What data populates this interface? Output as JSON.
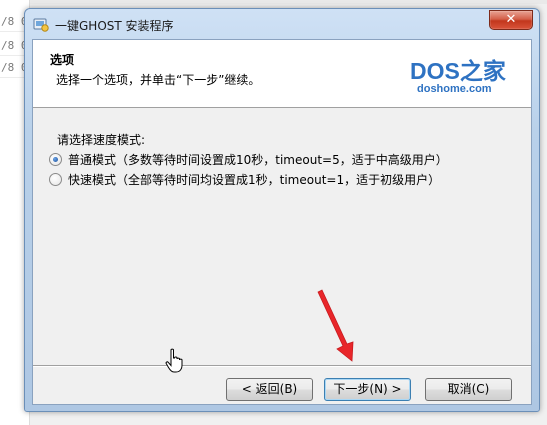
{
  "background": {
    "rows": [
      "/8 0",
      "/8 0",
      "/8 0"
    ]
  },
  "window": {
    "title": "一键GHOST 安装程序",
    "close_label": "✕",
    "icons": {
      "app": "installer-icon",
      "close": "close-icon"
    }
  },
  "header": {
    "title": "选项",
    "subtitle": "选择一个选项，并单击“下一步”继续。",
    "logo": {
      "name": "DOS之家",
      "url": "doshome.com"
    }
  },
  "body": {
    "prompt": "请选择速度模式:",
    "options": [
      {
        "label": "普通模式（多数等待时间设置成10秒，timeout=5，适于中高级用户）",
        "checked": true
      },
      {
        "label": "快速模式（全部等待时间均设置成1秒，timeout=1，适于初级用户）",
        "checked": false
      }
    ]
  },
  "buttons": {
    "back": "< 返回(B)",
    "next": "下一步(N) >",
    "cancel": "取消(C)"
  },
  "annotation": {
    "arrow_color": "#e8262a"
  }
}
